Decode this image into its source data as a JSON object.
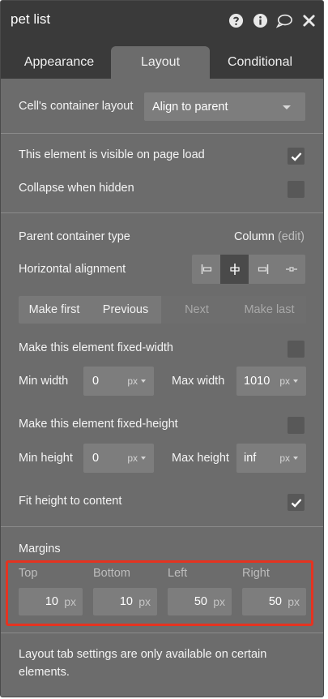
{
  "window": {
    "title": "pet list",
    "icons": [
      "help-icon",
      "info-icon",
      "comment-icon",
      "close-icon"
    ]
  },
  "tabs": [
    {
      "label": "Appearance",
      "active": false
    },
    {
      "label": "Layout",
      "active": true
    },
    {
      "label": "Conditional",
      "active": false
    }
  ],
  "cell_layout": {
    "label": "Cell's container layout",
    "value": "Align to parent"
  },
  "visibility": {
    "visible_label": "This element is visible on page load",
    "visible_checked": true,
    "collapse_label": "Collapse when hidden",
    "collapse_checked": false
  },
  "parent": {
    "label": "Parent container type",
    "value": "Column",
    "edit_link": "(edit)"
  },
  "horizontal": {
    "label": "Horizontal alignment",
    "options": [
      "align-left",
      "align-center",
      "align-right",
      "spread"
    ],
    "selected": "align-center"
  },
  "order": {
    "make_first": "Make first",
    "previous": "Previous",
    "next": "Next",
    "make_last": "Make last"
  },
  "fixed_width": {
    "label": "Make this element fixed-width",
    "checked": false
  },
  "width": {
    "min_label": "Min width",
    "min_value": "0",
    "min_unit": "px",
    "max_label": "Max width",
    "max_value": "1010",
    "max_unit": "px"
  },
  "fixed_height": {
    "label": "Make this element fixed-height",
    "checked": false
  },
  "height": {
    "min_label": "Min height",
    "min_value": "0",
    "min_unit": "px",
    "max_label": "Max height",
    "max_placeholder": "inf",
    "max_unit": "px"
  },
  "fit_height": {
    "label": "Fit height to content",
    "checked": true
  },
  "margins": {
    "title": "Margins",
    "top_label": "Top",
    "top_value": "10",
    "top_unit": "px",
    "bottom_label": "Bottom",
    "bottom_value": "10",
    "bottom_unit": "px",
    "left_label": "Left",
    "left_value": "50",
    "left_unit": "px",
    "right_label": "Right",
    "right_value": "50",
    "right_unit": "px"
  },
  "footer": {
    "note": "Layout tab settings are only available on certain elements."
  },
  "colors": {
    "highlight": "#e53320",
    "panel": "#6c6c6c",
    "header": "#3a3a3a"
  }
}
